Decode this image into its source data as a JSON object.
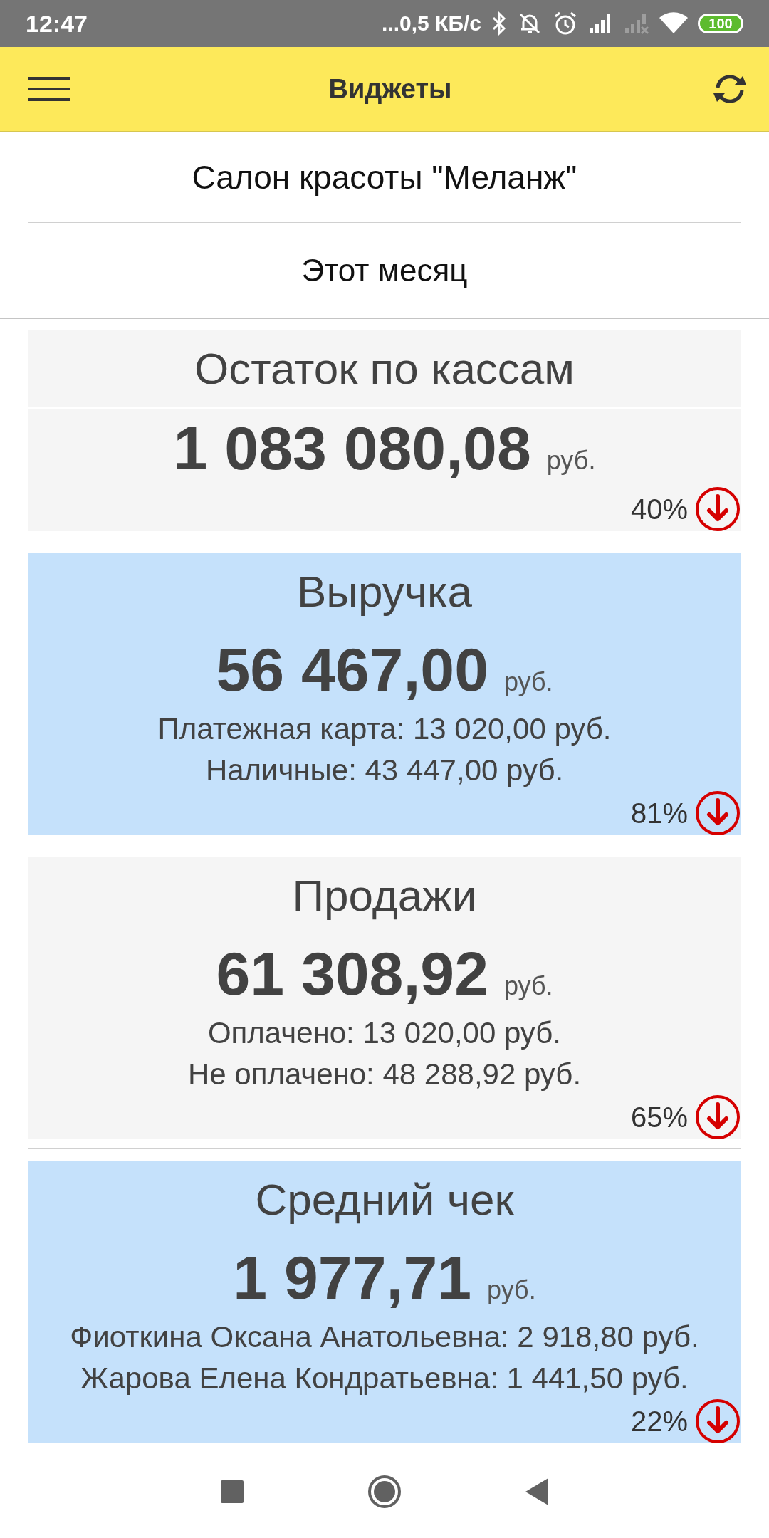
{
  "status_bar": {
    "time": "12:47",
    "network_speed": "...0,5 КБ/с",
    "battery": "100"
  },
  "app_bar": {
    "title": "Виджеты"
  },
  "organization": "Салон красоты \"Меланж\"",
  "period": "Этот месяц",
  "widgets": [
    {
      "title": "Остаток по кассам",
      "amount": "1 083 080,08",
      "currency": "руб.",
      "change": "40%",
      "kind": "decrease",
      "color": "#f5f5f5"
    },
    {
      "title": "Выручка",
      "amount": "56 467,00",
      "currency": "руб.",
      "details": [
        "Платежная карта: 13 020,00 руб.",
        "Наличные: 43 447,00 руб."
      ],
      "change": "81%",
      "kind": "decrease",
      "color": "#c5e1fb"
    },
    {
      "title": "Продажи",
      "amount": "61 308,92",
      "currency": "руб.",
      "details": [
        "Оплачено: 13 020,00 руб.",
        "Не оплачено: 48 288,92 руб."
      ],
      "change": "65%",
      "kind": "decrease",
      "color": "#f5f5f5"
    },
    {
      "title": "Средний чек",
      "amount": "1 977,71",
      "currency": "руб.",
      "details": [
        "Фиоткина Оксана Анатольевна: 2 918,80 руб.",
        "Жарова Елена Кондратьевна: 1 441,50 руб."
      ],
      "change": "22%",
      "kind": "decrease",
      "color": "#c5e1fb"
    }
  ]
}
